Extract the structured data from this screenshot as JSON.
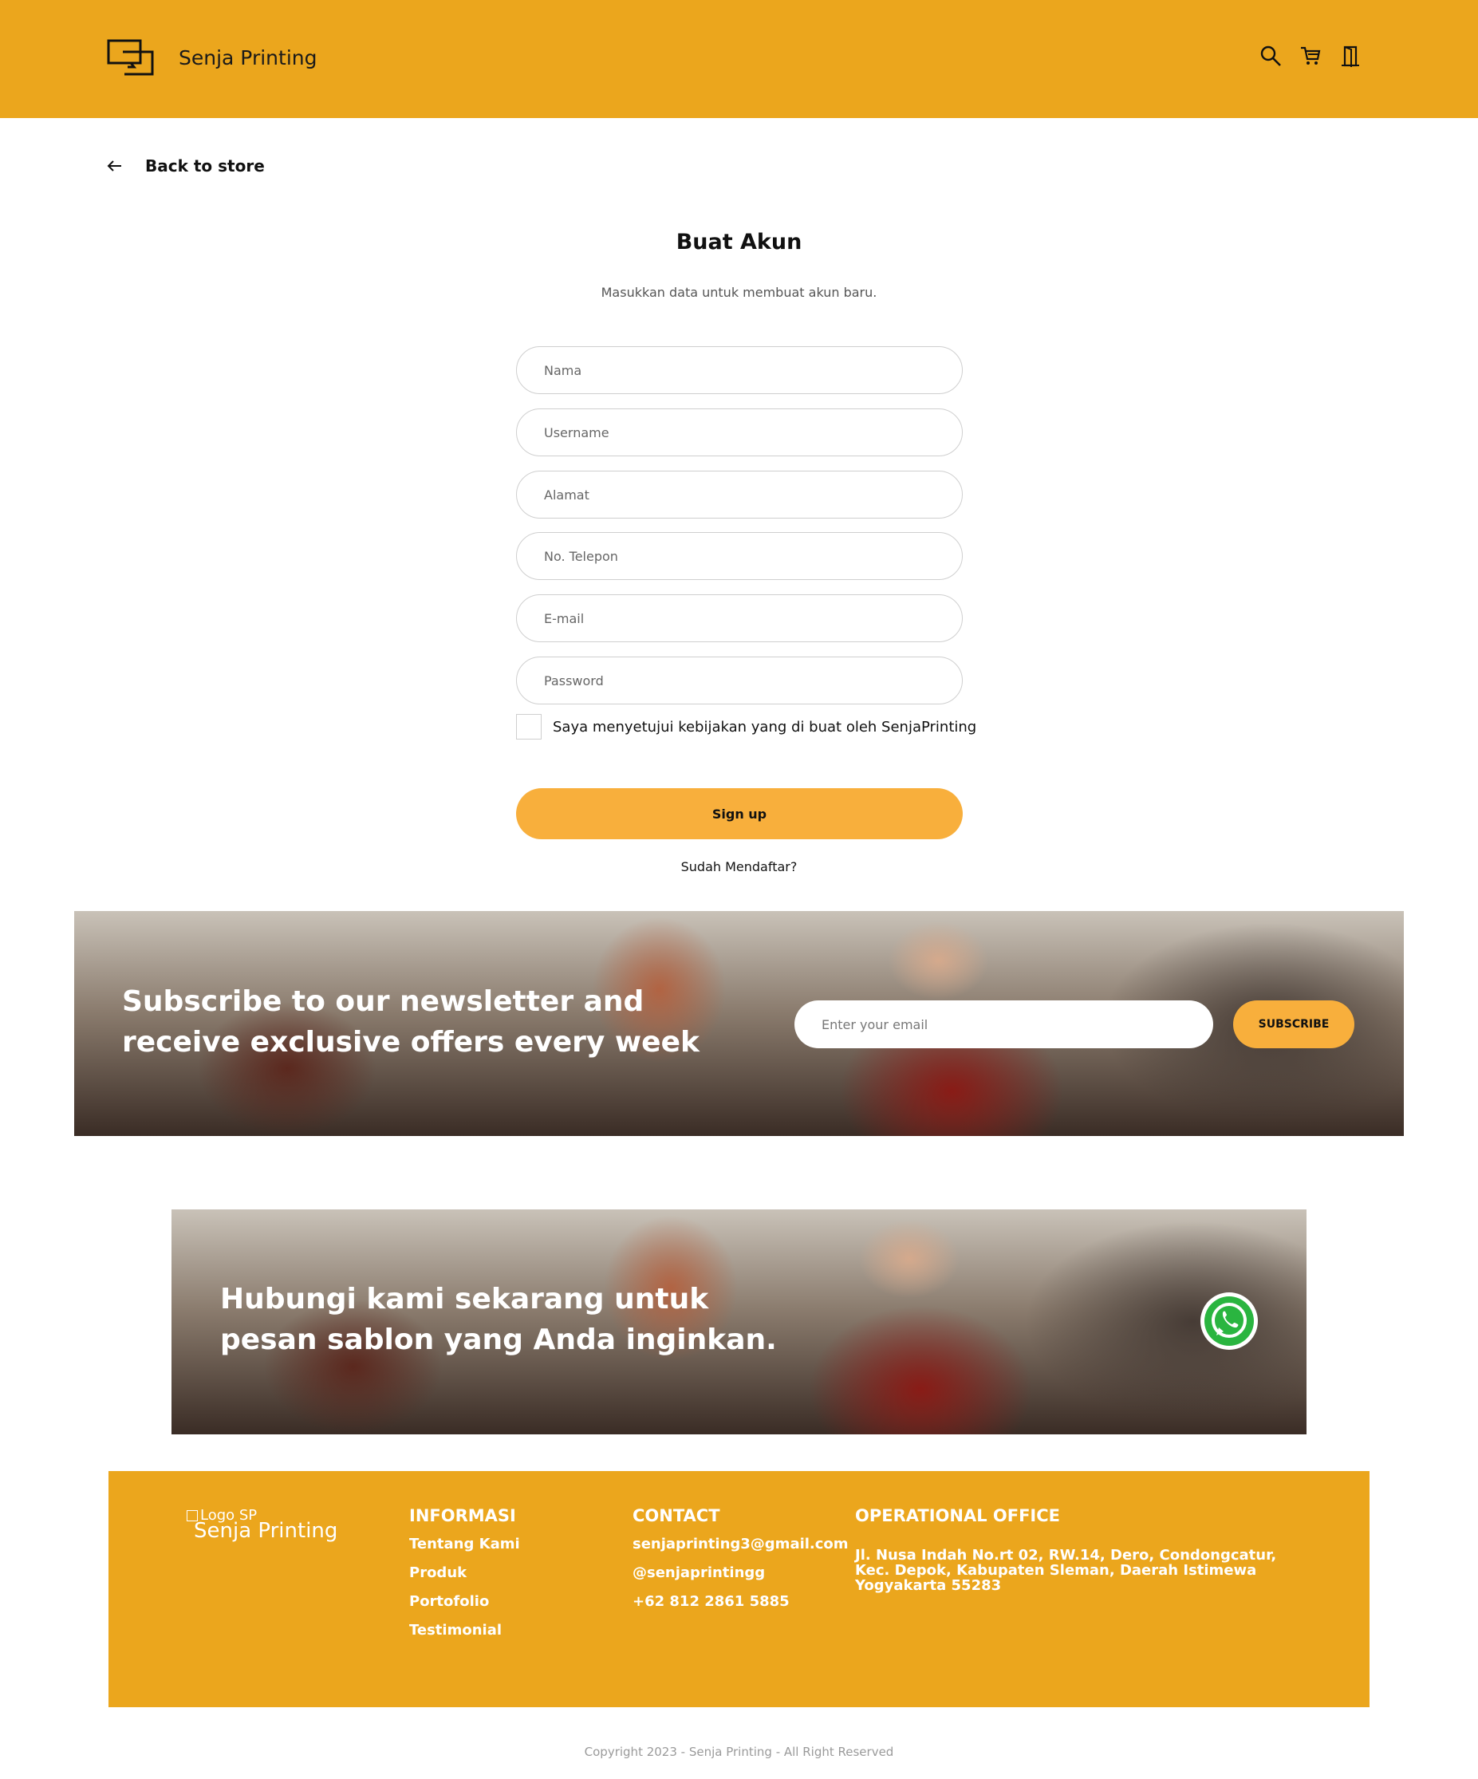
{
  "header": {
    "brand": "Senja Printing",
    "icons": [
      "search-icon",
      "cart-icon",
      "door-icon"
    ],
    "bg_color": "#EBA61D"
  },
  "back": {
    "label": "Back to store"
  },
  "form": {
    "title": "Buat Akun",
    "subtitle": "Masukkan data untuk membuat akun baru.",
    "placeholders": {
      "nama": "Nama",
      "username": "Username",
      "alamat": "Alamat",
      "telepon": "No. Telepon",
      "email": "E-mail",
      "password": "Password"
    },
    "agreement": "Saya menyetujui kebijakan yang di buat oleh SenjaPrinting",
    "signup_label": "Sign up",
    "already_label": "Sudah Mendaftar?",
    "button_color": "#F8AF3C"
  },
  "newsletter": {
    "heading": "Subscribe to our newsletter and receive exclusive offers every week",
    "email_placeholder": "Enter your email",
    "subscribe_label": "SUBSCRIBE"
  },
  "contact_banner": {
    "heading": "Hubungi kami sekarang untuk pesan sablon yang Anda inginkan."
  },
  "footer": {
    "logo_alt": "Logo SP",
    "brand": "Senja Printing",
    "informasi": {
      "title": "INFORMASI",
      "links": [
        "Tentang Kami",
        "Produk",
        "Portofolio",
        "Testimonial"
      ]
    },
    "contact": {
      "title": "CONTACT",
      "items": [
        "senjaprinting3@gmail.com",
        "@senjaprintingg",
        "+62 812 2861 5885"
      ]
    },
    "office": {
      "title": "OPERATIONAL OFFICE",
      "address": "Jl. Nusa Indah No.rt 02, RW.14, Dero, Condongcatur, Kec. Depok, Kabupaten Sleman, Daerah Istimewa Yogyakarta 55283"
    }
  },
  "copyright": "Copyright 2023 - Senja Printing - All Right Reserved"
}
